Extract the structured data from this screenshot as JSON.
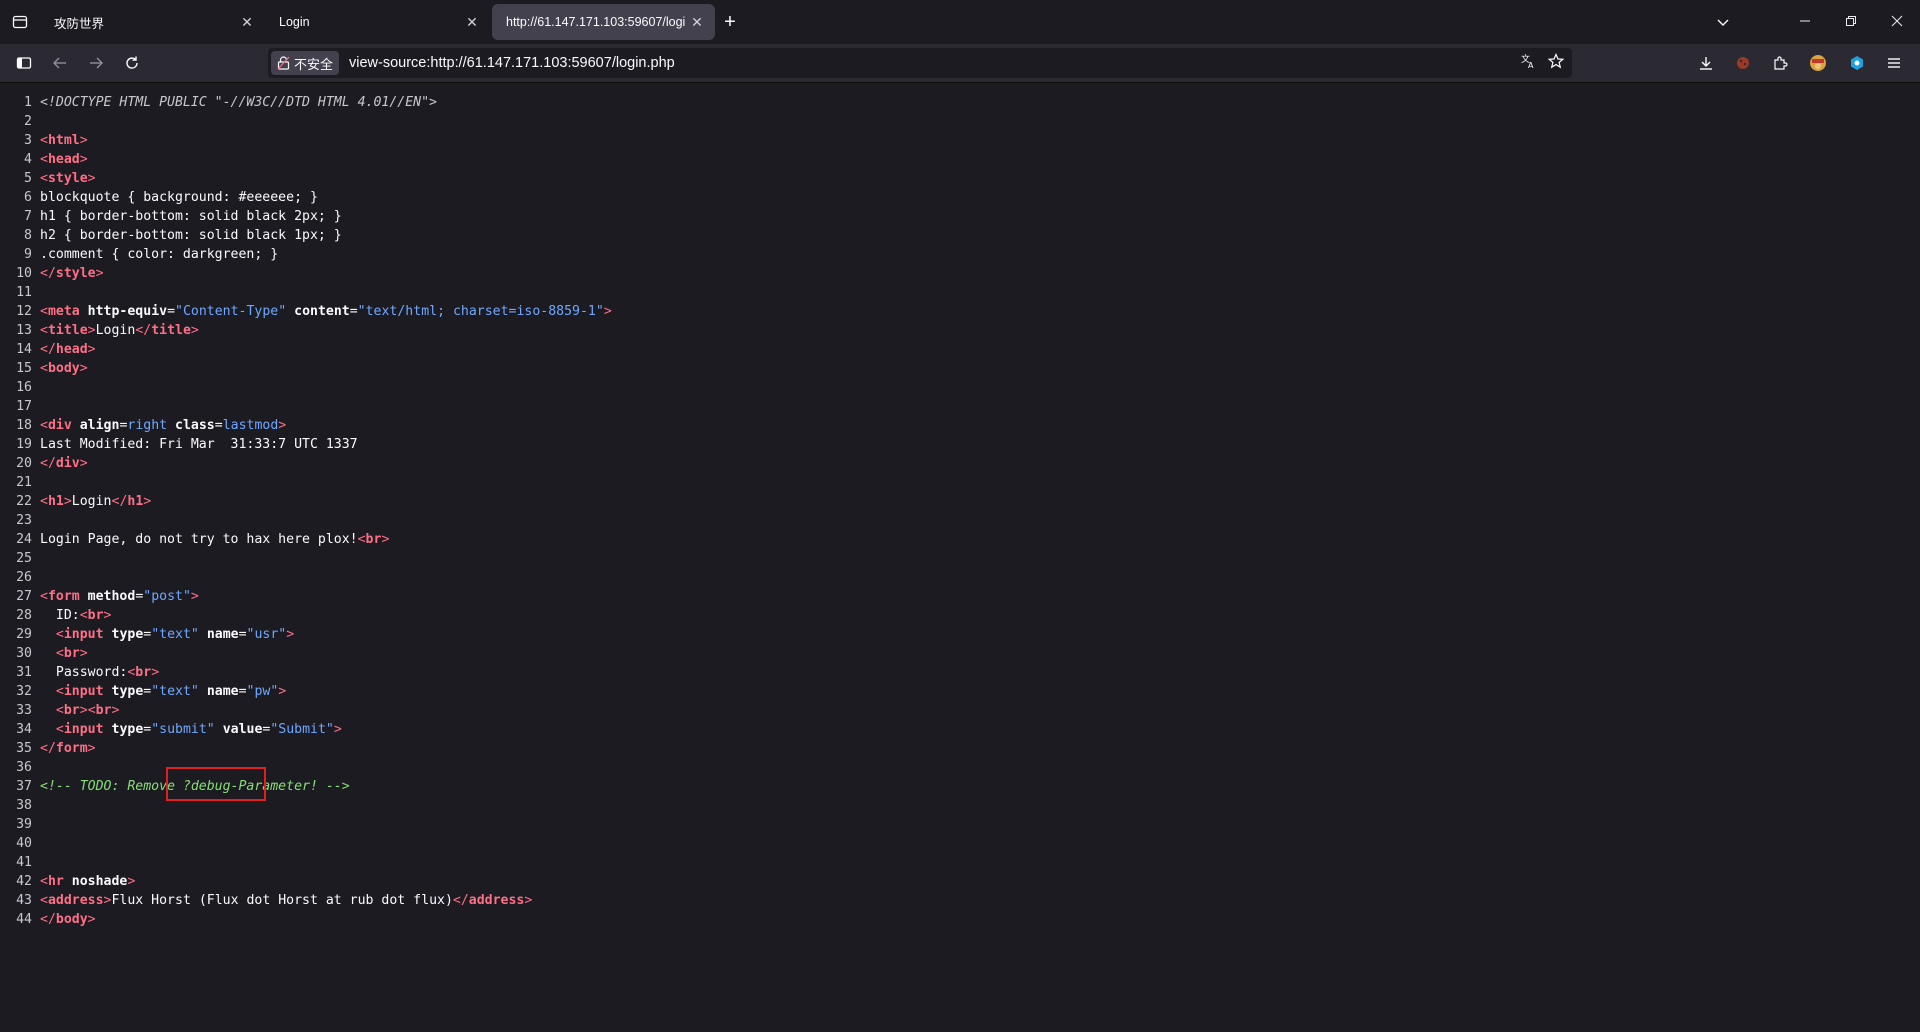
{
  "tabs": [
    {
      "title": "攻防世界",
      "active": false
    },
    {
      "title": "Login",
      "active": false
    },
    {
      "title": "http://61.147.171.103:59607/logi",
      "active": true
    }
  ],
  "nav": {
    "security_label": "不安全",
    "url": "view-source:http://61.147.171.103:59607/login.php"
  },
  "source_lines": [
    "<!DOCTYPE HTML PUBLIC \"-//W3C//DTD HTML 4.01//EN\">",
    "",
    "<html>",
    "<head>",
    "<style>",
    "blockquote { background: #eeeeee; }",
    "h1 { border-bottom: solid black 2px; }",
    "h2 { border-bottom: solid black 1px; }",
    ".comment { color: darkgreen; }",
    "</style>",
    "",
    "<meta http-equiv=\"Content-Type\" content=\"text/html; charset=iso-8859-1\">",
    "<title>Login</title>",
    "</head>",
    "<body>",
    "",
    "",
    "<div align=right class=lastmod>",
    "Last Modified: Fri Mar  31:33:7 UTC 1337",
    "</div>",
    "",
    "<h1>Login</h1>",
    "",
    "Login Page, do not try to hax here plox!<br>",
    "",
    "",
    "<form method=\"post\">",
    "  ID:<br>",
    "  <input type=\"text\" name=\"usr\">",
    "  <br>",
    "  Password:<br>",
    "  <input type=\"text\" name=\"pw\">",
    "  <br><br>",
    "  <input type=\"submit\" value=\"Submit\">",
    "</form>",
    "",
    "<!-- TODO: Remove ?debug-Parameter! -->",
    "",
    "",
    "",
    "",
    "<hr noshade>",
    "<address>Flux Horst (Flux dot Horst at rub dot flux)</address>",
    "</body>"
  ],
  "colors": {
    "tag": "#ff6f86",
    "attr_value": "#6ea8ff",
    "comment": "#86de74",
    "highlight_box": "#e02020"
  }
}
